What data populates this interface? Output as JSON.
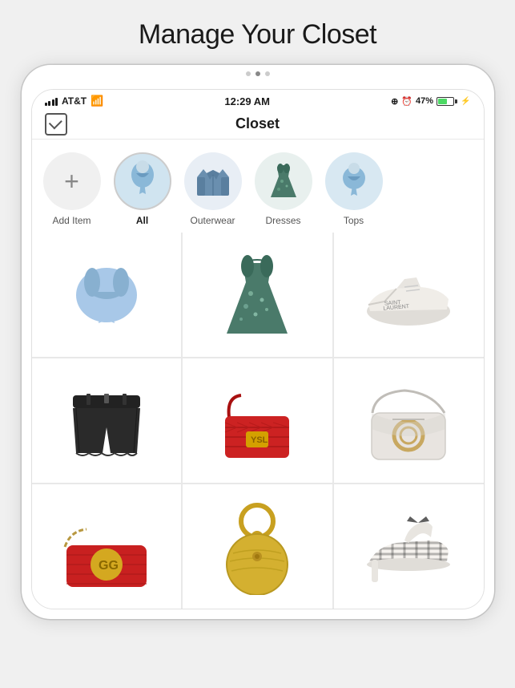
{
  "page": {
    "title": "Manage Your Closet",
    "dots": [
      false,
      true,
      false
    ]
  },
  "statusBar": {
    "carrier": "AT&T",
    "time": "12:29 AM",
    "battery": "47%"
  },
  "navBar": {
    "title": "Closet"
  },
  "categories": [
    {
      "id": "add",
      "label": "Add Item",
      "type": "add"
    },
    {
      "id": "all",
      "label": "All",
      "type": "cat",
      "active": true,
      "emoji": "👗"
    },
    {
      "id": "outerwear",
      "label": "Outerwear",
      "type": "cat",
      "emoji": "🧥"
    },
    {
      "id": "dresses",
      "label": "Dresses",
      "type": "cat",
      "emoji": "👗"
    },
    {
      "id": "tops",
      "label": "Tops",
      "type": "cat",
      "emoji": "👕"
    }
  ],
  "grid": {
    "items": [
      {
        "id": "crop-top",
        "emoji": "👚",
        "color": "#a8c8e8"
      },
      {
        "id": "floral-dress",
        "emoji": "👗",
        "color": "#5a8a7a"
      },
      {
        "id": "sneakers",
        "emoji": "👟",
        "color": "#f0ede8"
      },
      {
        "id": "black-shorts",
        "emoji": "🩳",
        "color": "#2a2a2a"
      },
      {
        "id": "red-bag",
        "emoji": "👜",
        "color": "#cc2222"
      },
      {
        "id": "white-bag",
        "emoji": "👜",
        "color": "#e8e4e0"
      },
      {
        "id": "gucci-bag",
        "emoji": "👜",
        "color": "#cc2222"
      },
      {
        "id": "yellow-bag",
        "emoji": "👛",
        "color": "#d4b840"
      },
      {
        "id": "heels",
        "emoji": "👠",
        "color": "#f0ede8"
      }
    ]
  }
}
